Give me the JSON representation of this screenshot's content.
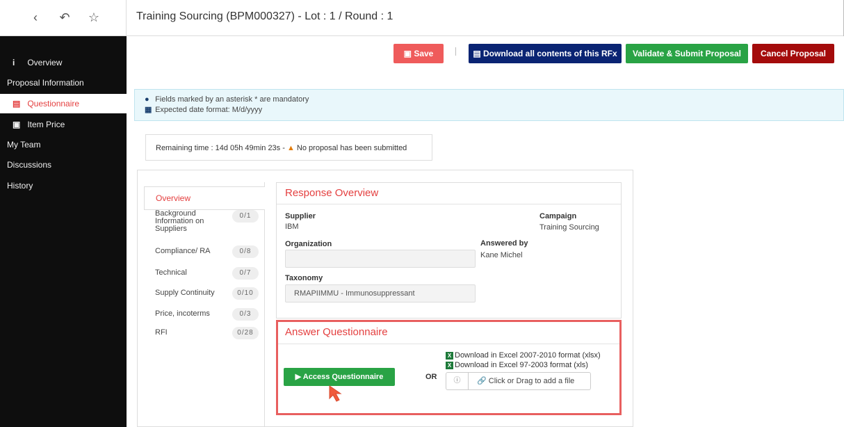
{
  "topbar": {
    "back_icon": "‹",
    "history_icon": "↶",
    "star_icon": "☆",
    "title": "Training Sourcing (BPM000327) - Lot : 1 / Round : 1"
  },
  "sidebar": {
    "items": [
      {
        "icon": "i",
        "label": "Overview"
      },
      {
        "icon": "",
        "label": "Proposal Information"
      },
      {
        "icon": "▤",
        "label": "Questionnaire"
      },
      {
        "icon": "▣",
        "label": "Item Price"
      },
      {
        "icon": "",
        "label": "My Team"
      },
      {
        "icon": "",
        "label": "Discussions"
      },
      {
        "icon": "",
        "label": "History"
      }
    ]
  },
  "actions": {
    "save": "Save",
    "download": "Download all contents of this RFx",
    "validate": "Validate & Submit Proposal",
    "cancel": "Cancel Proposal"
  },
  "banner": {
    "line1": "Fields marked by an asterisk * are mandatory",
    "line2": "Expected date format: M/d/yyyy"
  },
  "remaining": {
    "label": "Remaining time :",
    "value": "14d 05h 49min 23s -",
    "warning": "No proposal has been submitted"
  },
  "qnav": {
    "active": "Overview",
    "items": [
      {
        "label": "Background Information on Suppliers",
        "count": "0/1"
      },
      {
        "label": "Compliance/ RA",
        "count": "0/8"
      },
      {
        "label": "Technical",
        "count": "0/7"
      },
      {
        "label": "Supply Continuity",
        "count": "0/10"
      },
      {
        "label": "Price, incoterms",
        "count": "0/3"
      },
      {
        "label": "RFI",
        "count": "0/28"
      }
    ]
  },
  "overview": {
    "title": "Response Overview",
    "supplier_label": "Supplier",
    "supplier_value": "IBM",
    "campaign_label": "Campaign",
    "campaign_value": "Training Sourcing",
    "organization_label": "Organization",
    "organization_value": "",
    "answered_label": "Answered by",
    "answered_value": "Kane Michel",
    "taxonomy_label": "Taxonomy",
    "taxonomy_value": "RMAPIIMMU - Immunosuppressant"
  },
  "answer": {
    "title": "Answer Questionnaire",
    "access_button": "▶ Access Questionnaire",
    "or": "OR",
    "download_xlsx": "Download in Excel 2007-2010 format (xlsx)",
    "download_xls": "Download in Excel 97-2003 format (xls)",
    "upload_info": "ⓘ",
    "upload_text": "🔗 Click or Drag to add a file"
  },
  "colors": {
    "accent_red": "#e43f3f",
    "save": "#ef5b5b",
    "download": "#0a2473",
    "validate": "#29a345",
    "cancel": "#a40b0b",
    "sidebar": "#0e0e0e"
  }
}
